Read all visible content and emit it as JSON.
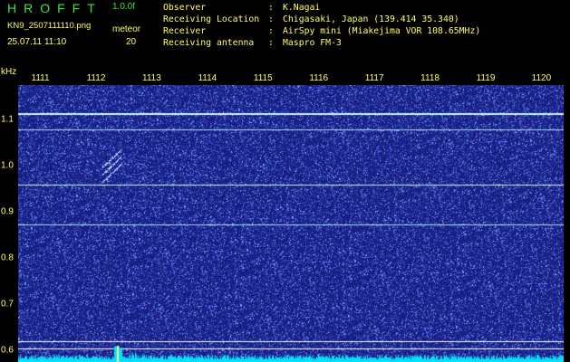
{
  "header": {
    "app_title": "HROFFT",
    "version": "1.0.0f",
    "filename": "KN9_2507111110.png",
    "mode_label": "meteor",
    "datetime": "25.07.11 11:10",
    "mode_value": "20"
  },
  "info": [
    {
      "label": "Observer",
      "value": "K.Nagai"
    },
    {
      "label": "Receiving Location",
      "value": "Chigasaki, Japan (139.414 35.340)"
    },
    {
      "label": "Receiver",
      "value": "AirSpy mini (Miakejima VOR 108.65MHz)"
    },
    {
      "label": "Receiving antenna",
      "value": "Maspro FM-3"
    }
  ],
  "chart_data": {
    "type": "heatmap",
    "ylabel": "kHz",
    "x_ticks": [
      "1111",
      "1112",
      "1113",
      "1114",
      "1115",
      "1116",
      "1117",
      "1118",
      "1119",
      "1120"
    ],
    "y_ticks": [
      "1.1",
      "1.0",
      "0.9",
      "0.8",
      "0.7",
      "0.6"
    ],
    "ylim": [
      0.575,
      1.175
    ],
    "xlim": [
      1110.6,
      1120.4
    ],
    "carrier_lines_khz": [
      1.115,
      1.078,
      0.96,
      0.873
    ],
    "reference_lines_khz": [
      0.62,
      0.604
    ],
    "meteor_echo": {
      "x_start": 1112.1,
      "x_end": 1112.45,
      "y_start": 0.98,
      "y_end": 1.02
    },
    "colors": {
      "background": "#1a1f8a",
      "noise_high": "#5a7cff",
      "carrier": "#8ec8ff",
      "strong_carrier": "#c8f4ff",
      "reference_line": "#ffffff",
      "baseline_fill": "#00e0ff"
    }
  }
}
